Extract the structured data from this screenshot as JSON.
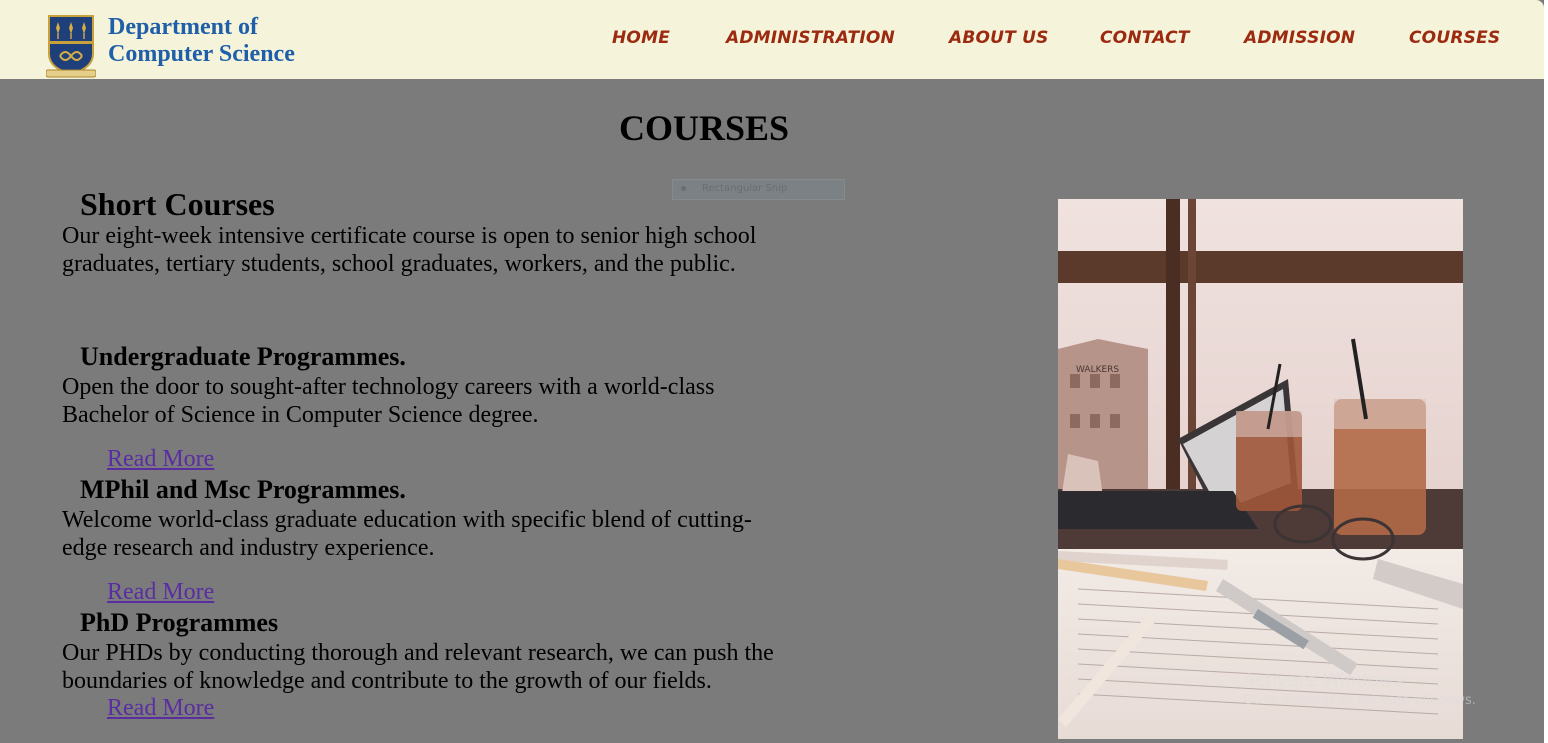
{
  "header": {
    "brand_line1": "Department of",
    "brand_line2": "Computer Science"
  },
  "nav": [
    "HOME",
    "ADMINISTRATION",
    "ABOUT US",
    "CONTACT",
    "ADMISSION",
    "COURSES"
  ],
  "page": {
    "title": "COURSES"
  },
  "snip_tooltip": "Rectangular Snip",
  "sections": [
    {
      "heading": "Short Courses",
      "text": "Our eight-week intensive certificate course is open to senior high school graduates, tertiary students, school graduates, workers, and the public."
    },
    {
      "heading": "Undergraduate Programmes.",
      "text": "Open the door to sought-after technology careers with a world-class Bachelor of Science in Computer Science degree.",
      "link": "Read More"
    },
    {
      "heading": "MPhil and Msc Programmes.",
      "text": "Welcome world-class graduate education with specific blend of cutting-edge research and industry experience.",
      "link": "Read More"
    },
    {
      "heading": "PhD Programmes",
      "text": "Our PHDs by conducting thorough and relevant research, we can push the boundaries of knowledge and contribute to the growth of our fields.",
      "link": "Read More"
    }
  ],
  "photo_sign": "WALKERS",
  "watermark": {
    "line1": "Activate Windows",
    "line2": "Go to Settings to activate Windows."
  },
  "colors": {
    "header_bg": "#f5f4da",
    "brand": "#1f5ea8",
    "nav": "#9b2a10",
    "page_bg": "#7b7b7b",
    "link": "#5a2da1"
  }
}
